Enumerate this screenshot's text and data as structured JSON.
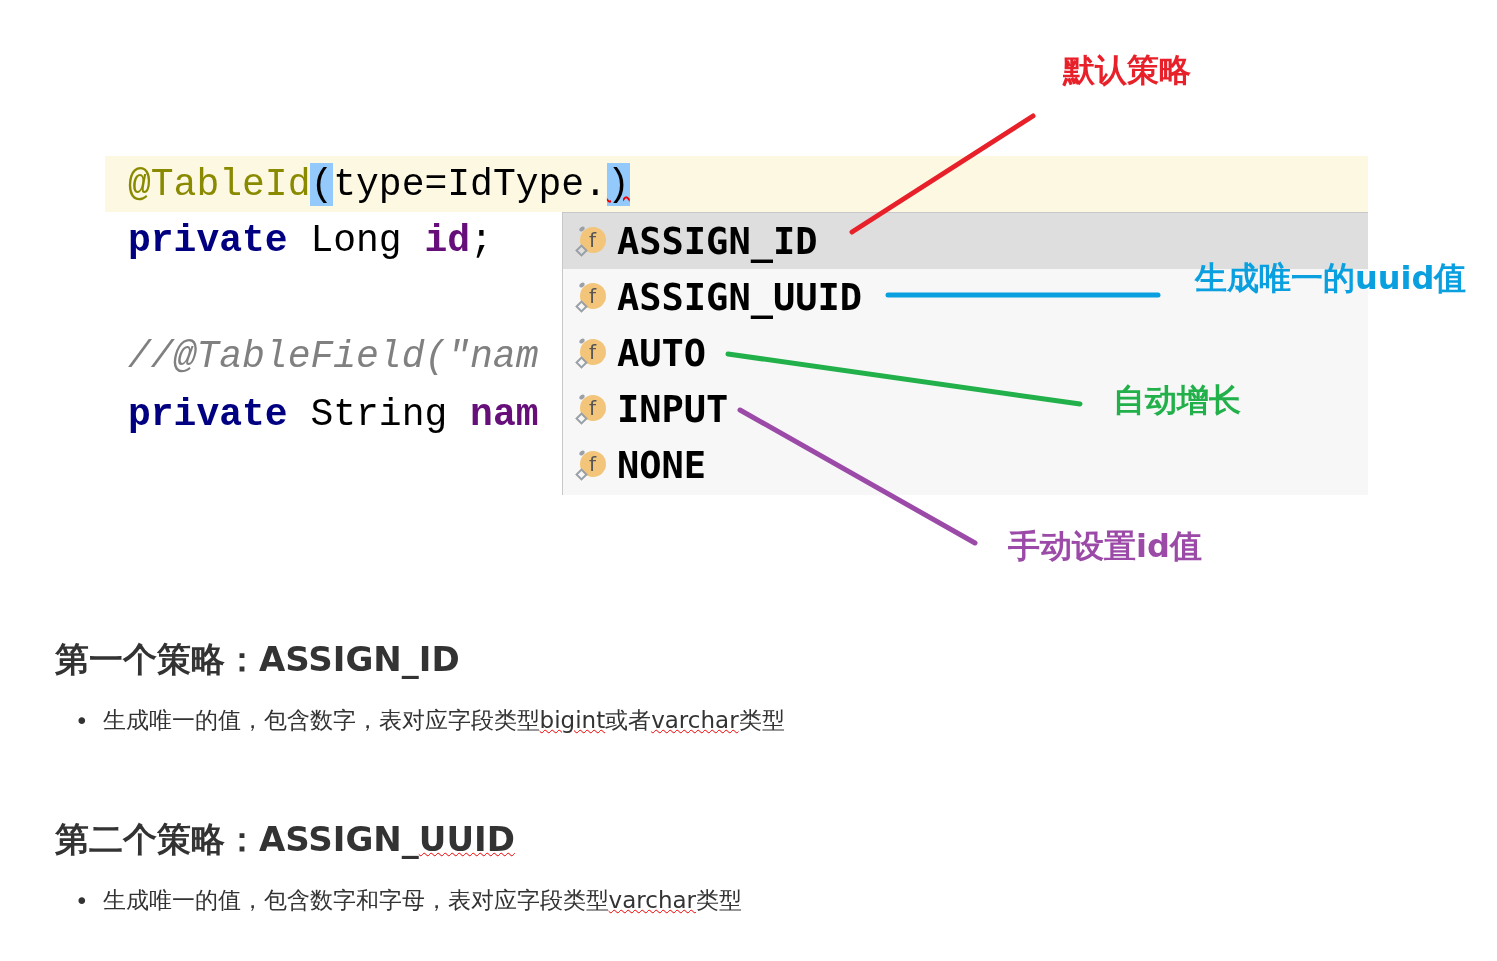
{
  "editor": {
    "lines": [
      {
        "current": true,
        "segments": [
          {
            "kind": "annotation",
            "text": "@TableId"
          },
          {
            "kind": "brace-match",
            "text": "("
          },
          {
            "kind": "plain",
            "text": "type=IdType."
          },
          {
            "kind": "brace-match",
            "text": ")",
            "error": true
          }
        ]
      },
      {
        "current": false,
        "segments": [
          {
            "kind": "keyword",
            "text": "private"
          },
          {
            "kind": "plain",
            "text": " Long "
          },
          {
            "kind": "field",
            "text": "id"
          },
          {
            "kind": "plain",
            "text": ";"
          }
        ]
      },
      {
        "current": false,
        "blank_before": true,
        "segments": [
          {
            "kind": "comment",
            "text": "//@TableField(\"nam"
          }
        ]
      },
      {
        "current": false,
        "segments": [
          {
            "kind": "keyword",
            "text": "private"
          },
          {
            "kind": "plain",
            "text": " String "
          },
          {
            "kind": "field",
            "text": "nam"
          }
        ]
      }
    ]
  },
  "completion_popup": {
    "items": [
      {
        "icon_letter": "f",
        "label": "ASSIGN_ID",
        "selected": true
      },
      {
        "icon_letter": "f",
        "label": "ASSIGN_UUID",
        "selected": false
      },
      {
        "icon_letter": "f",
        "label": "AUTO",
        "selected": false
      },
      {
        "icon_letter": "f",
        "label": "INPUT",
        "selected": false
      },
      {
        "icon_letter": "f",
        "label": "NONE",
        "selected": false
      }
    ]
  },
  "annotations": [
    {
      "text": "默认策略",
      "color": "#e8202a"
    },
    {
      "text": "生成唯一的uuid值",
      "color": "#0aa0e0"
    },
    {
      "text": "自动增长",
      "color": "#22b04a"
    },
    {
      "text": "手动设置id值",
      "color": "#9b4aa8"
    }
  ],
  "sections": [
    {
      "heading": [
        {
          "text": "第一个策略：ASSIGN_ID",
          "misspelled": false
        }
      ],
      "bullets": [
        {
          "marker": "•",
          "segments": [
            {
              "text": "生成唯一的值，包含数字，表对应字段类型",
              "misspelled": false
            },
            {
              "text": "bigint",
              "misspelled": true
            },
            {
              "text": "或者",
              "misspelled": false
            },
            {
              "text": "varchar",
              "misspelled": true
            },
            {
              "text": "类型",
              "misspelled": false
            }
          ]
        }
      ]
    },
    {
      "heading": [
        {
          "text": "第二个策略：ASSIGN_",
          "misspelled": false
        },
        {
          "text": "UUID",
          "misspelled": true
        }
      ],
      "bullets": [
        {
          "marker": "•",
          "segments": [
            {
              "text": "生成唯一的值，包含数字和字母，表对应字段类型",
              "misspelled": false
            },
            {
              "text": "varchar",
              "misspelled": true
            },
            {
              "text": "类型",
              "misspelled": false
            }
          ]
        }
      ]
    }
  ]
}
